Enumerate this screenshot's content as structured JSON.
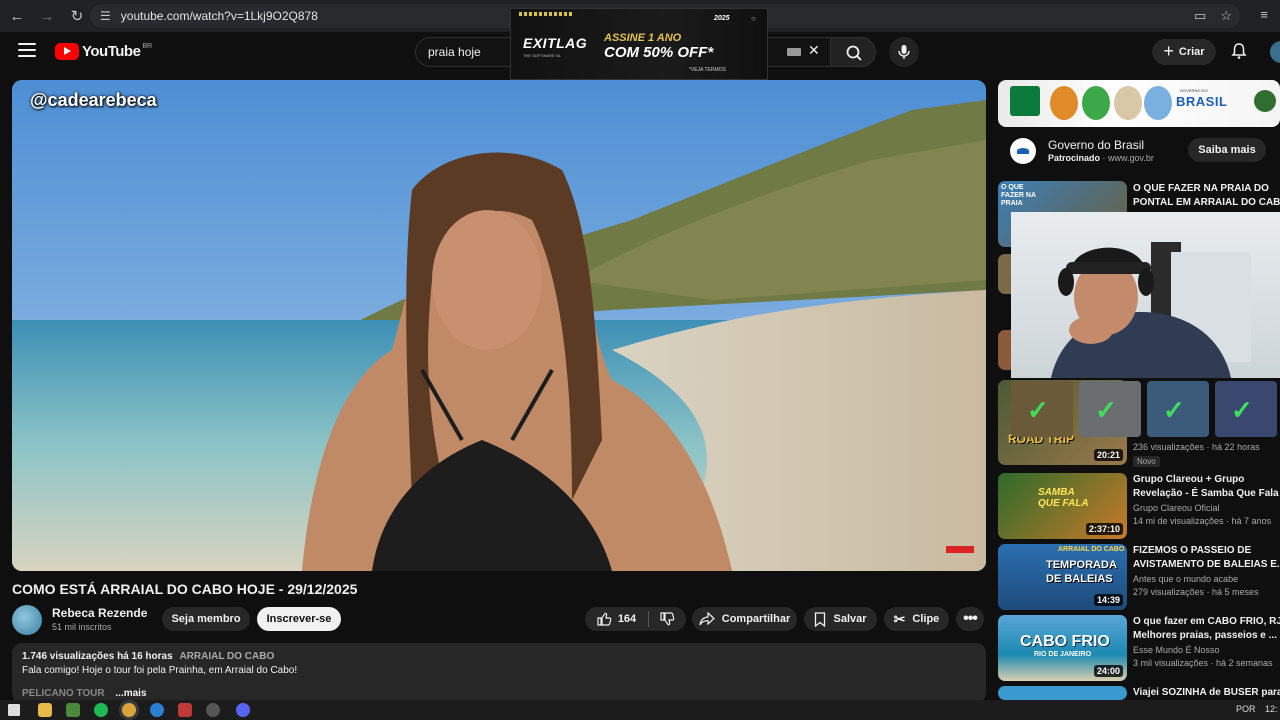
{
  "browser": {
    "url": "youtube.com/watch?v=1Lkj9O2Q878"
  },
  "header": {
    "logo_text": "YouTube",
    "country_code": "BR",
    "search_value": "praia hoje",
    "create_label": "Criar"
  },
  "ad_overlay": {
    "brand": "EXITLAG",
    "brand_sub": "THE SOFTWARE N1",
    "line1": "ASSINE 1 ANO",
    "line2": "COM 50% OFF*",
    "note": "*VEJA TERMOS",
    "tag": "2025"
  },
  "player": {
    "channel_tag": "@cadearebeca"
  },
  "video": {
    "title": "COMO ESTÁ ARRAIAL DO CABO HOJE - 29/12/2025",
    "channel": "Rebeca Rezende",
    "subscribers": "51 mil inscritos",
    "join_label": "Seja membro",
    "subscribe_label": "Inscrever-se",
    "likes": "164",
    "share_label": "Compartilhar",
    "save_label": "Salvar",
    "clip_label": "Clipe"
  },
  "description": {
    "stats": "1.746 visualizações  há 16 horas",
    "location_tag": "ARRAIAL DO CABO",
    "text": "Fala comigo! Hoje o tour foi pela Prainha, em Arraial do Cabo!",
    "more_preview": "PELICANO TOUR",
    "more_label": "...mais"
  },
  "sidebar": {
    "ad": {
      "banner_text": "BRASIL",
      "banner_small": "GOVERNO DO",
      "advertiser": "Governo do Brasil",
      "sponsored_label": "Patrocinado",
      "sponsored_url": "· www.gov.br",
      "cta": "Saiba mais"
    },
    "videos": [
      {
        "title1": "O QUE FAZER NA PRAIA DO",
        "title2": "PONTAL EM ARRAIAL DO CABO",
        "thumb_text": "O QUE FAZER NA PRAIA"
      },
      {
        "duration": "20:21",
        "thumb_text": "ROAD TRIP",
        "meta": "236 visualizações · há 22 horas",
        "badge": "Novo"
      },
      {
        "title1": "Grupo Clareou + Grupo",
        "title2": "Revelação - É Samba Que Fala",
        "channel": "Grupo Clareou Oficial",
        "meta": "14 mi de visualizações · há 7 anos",
        "duration": "2:37:10",
        "thumb_text": "SAMBA QUE FALA"
      },
      {
        "title1": "FIZEMOS O PASSEIO DE",
        "title2": "AVISTAMENTO DE BALEIAS E...",
        "channel": "Antes que o mundo acabe",
        "meta": "279 visualizações · há 5 meses",
        "duration": "14:39",
        "thumb_text": "TEMPORADA DE BALEIAS",
        "thumb_small": "ARRAIAL DO CABO"
      },
      {
        "title1": "O que fazer em CABO FRIO, RJ",
        "title2": "Melhores praias, passeios e ...",
        "channel": "Esse Mundo É Nosso",
        "meta": "3 mil visualizações · há 2 semanas",
        "duration": "24:00",
        "thumb_text": "CABO FRIO",
        "thumb_small": "RIO DE JANEIRO"
      },
      {
        "title1": "Viajei SOZINHA de BUSER para"
      }
    ]
  },
  "taskbar": {
    "lang": "POR",
    "time": "12:"
  },
  "colors": {
    "background": "#0f0f0f",
    "yt_red": "#ff0000",
    "chip": "#272727",
    "subscribe_bg": "#f1f1f1",
    "check_green": "#3ee05a"
  },
  "icons": {
    "back": "arrow-left-icon",
    "forward": "arrow-right-icon",
    "reload": "reload-icon",
    "site_info": "tune-icon",
    "search": "search-icon",
    "mic": "mic-icon",
    "bell": "bell-icon",
    "like": "thumbs-up-icon",
    "dislike": "thumbs-down-icon",
    "share": "share-icon",
    "save": "bookmark-icon",
    "clip": "scissors-icon",
    "more": "more-horiz-icon"
  }
}
